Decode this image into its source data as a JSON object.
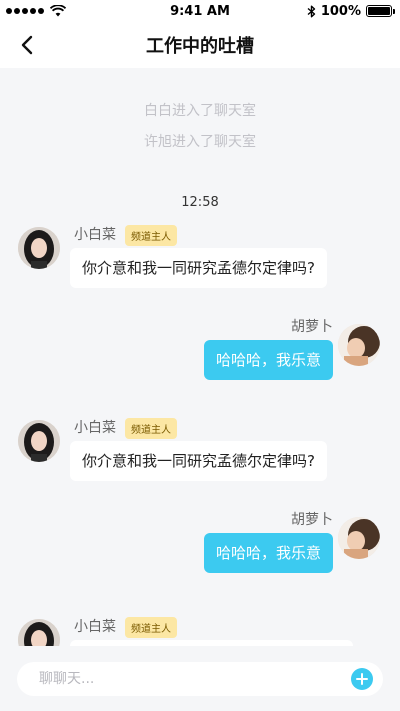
{
  "status_bar": {
    "time": "9:41 AM",
    "battery": "100%",
    "battery_level": 1.0,
    "icons": [
      "signal-dots-icon",
      "wifi-icon",
      "bluetooth-icon",
      "battery-icon"
    ]
  },
  "header": {
    "title": "工作中的吐槽",
    "back_icon": "chevron-left-icon"
  },
  "system_messages": [
    "白白进入了聊天室",
    "许旭进入了聊天室"
  ],
  "timestamp": "12:58",
  "messages": [
    {
      "side": "left",
      "name": "小白菜",
      "badge": "频道主人",
      "text": "你介意和我一同研究孟德尔定律吗?"
    },
    {
      "side": "right",
      "name": "胡萝卜",
      "text": "哈哈哈，我乐意"
    },
    {
      "side": "left",
      "name": "小白菜",
      "badge": "频道主人",
      "text": "你介意和我一同研究孟德尔定律吗?"
    },
    {
      "side": "right",
      "name": "胡萝卜",
      "text": "哈哈哈，我乐意"
    },
    {
      "side": "left",
      "name": "小白菜",
      "badge": "频道主人",
      "text": ""
    }
  ],
  "input": {
    "placeholder": "聊聊天...",
    "value": "",
    "add_icon": "plus-circle-icon"
  },
  "colors": {
    "accent": "#3ccaf0",
    "badge_bg": "#fce7a4",
    "background": "#f5f6f8"
  }
}
